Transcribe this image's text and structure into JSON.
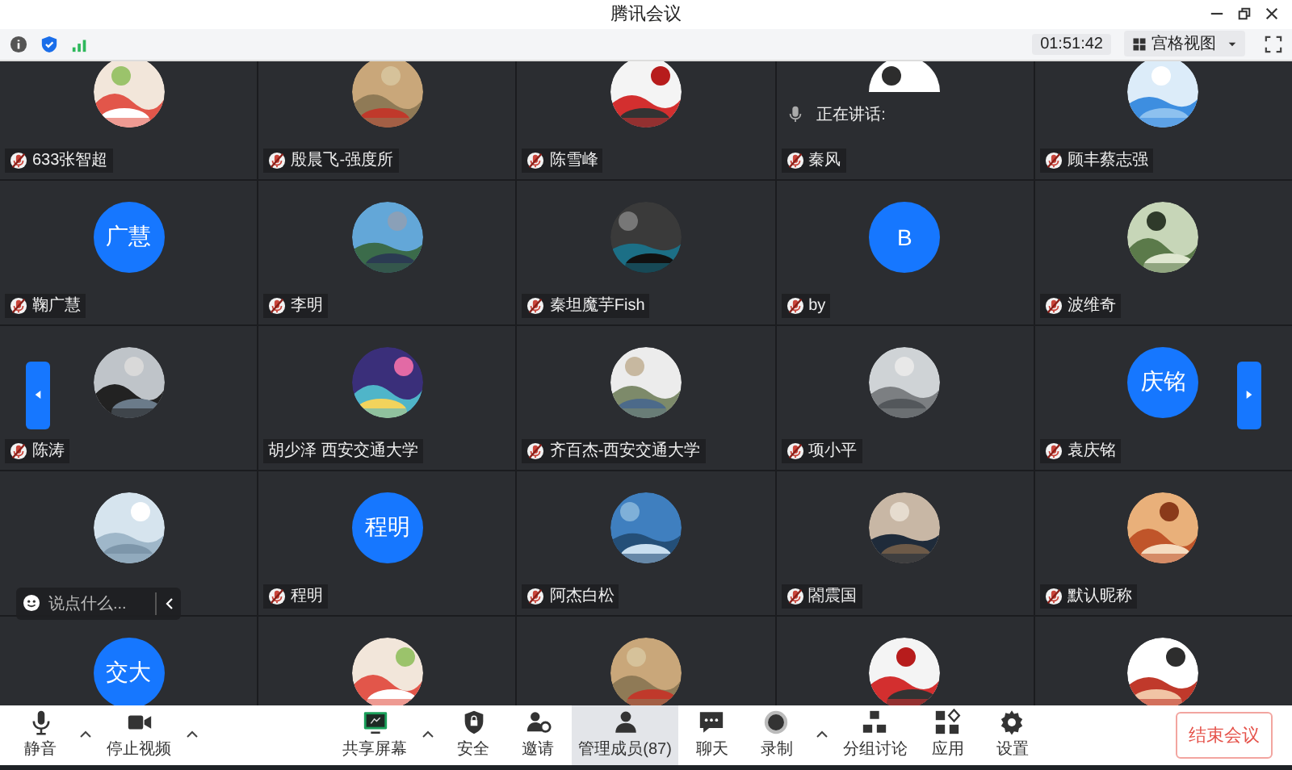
{
  "window": {
    "title": "腾讯会议"
  },
  "toolbar": {
    "timer": "01:51:42",
    "view_button": {
      "label": "宫格视图"
    }
  },
  "chat_input": {
    "placeholder": "说点什么..."
  },
  "page_arrows": {
    "previous": true,
    "next": true
  },
  "tiles": [
    {
      "avatar": {
        "kind": "picture"
      },
      "name": "633张智超",
      "muted": true
    },
    {
      "avatar": {
        "kind": "picture"
      },
      "name": "殷晨飞-强度所",
      "muted": true
    },
    {
      "avatar": {
        "kind": "picture"
      },
      "name": "陈雪峰",
      "muted": true
    },
    {
      "avatar": {
        "kind": "picture"
      },
      "name": "秦风",
      "muted": true,
      "speaking": {
        "label": "正在讲话:"
      }
    },
    {
      "avatar": {
        "kind": "picture"
      },
      "name": "顾丰蔡志强",
      "muted": true
    },
    {
      "avatar": {
        "kind": "initials",
        "text": "广慧"
      },
      "name": "鞠广慧",
      "muted": true
    },
    {
      "avatar": {
        "kind": "picture"
      },
      "name": "李明",
      "muted": true
    },
    {
      "avatar": {
        "kind": "picture"
      },
      "name": "秦坦魔芋Fish",
      "muted": true
    },
    {
      "avatar": {
        "kind": "initials",
        "text": "B"
      },
      "name": "by",
      "muted": true
    },
    {
      "avatar": {
        "kind": "picture"
      },
      "name": "波维奇",
      "muted": true
    },
    {
      "avatar": {
        "kind": "picture"
      },
      "name": "陈涛",
      "muted": true
    },
    {
      "avatar": {
        "kind": "picture"
      },
      "name": "胡少泽 西安交通大学",
      "muted": false
    },
    {
      "avatar": {
        "kind": "picture"
      },
      "name": "齐百杰-西安交通大学",
      "muted": true
    },
    {
      "avatar": {
        "kind": "picture"
      },
      "name": "项小平",
      "muted": true
    },
    {
      "avatar": {
        "kind": "initials",
        "text": "庆铭"
      },
      "name": "袁庆铭",
      "muted": true
    },
    {
      "avatar": {
        "kind": "picture"
      }
    },
    {
      "avatar": {
        "kind": "initials",
        "text": "程明"
      },
      "name": "程明",
      "muted": true
    },
    {
      "avatar": {
        "kind": "picture"
      },
      "name": "阿杰白松",
      "muted": true
    },
    {
      "avatar": {
        "kind": "picture"
      },
      "name": "閤震国",
      "muted": true
    },
    {
      "avatar": {
        "kind": "picture"
      },
      "name": "默认昵称",
      "muted": true
    },
    {
      "avatar": {
        "kind": "initials",
        "text": "交大"
      }
    },
    {
      "avatar": {
        "kind": "picture"
      }
    },
    {
      "avatar": {
        "kind": "picture"
      }
    },
    {
      "avatar": {
        "kind": "picture"
      }
    },
    {
      "avatar": {
        "kind": "picture"
      }
    }
  ],
  "bottom_bar": {
    "items": [
      {
        "kind": "mic",
        "label": "静音",
        "caret": true,
        "selected": false
      },
      {
        "kind": "camera",
        "label": "停止视频",
        "caret": true,
        "selected": false
      },
      {
        "kind": "spacer"
      },
      {
        "kind": "share",
        "label": "共享屏幕",
        "caret": true,
        "selected": false
      },
      {
        "kind": "shield",
        "label": "安全",
        "caret": false,
        "selected": false
      },
      {
        "kind": "invite",
        "label": "邀请",
        "caret": false,
        "selected": false
      },
      {
        "kind": "members",
        "label": "管理成员(87)",
        "caret": false,
        "selected": true
      },
      {
        "kind": "chat",
        "label": "聊天",
        "caret": false,
        "selected": false
      },
      {
        "kind": "record",
        "label": "录制",
        "caret": true,
        "selected": false
      },
      {
        "kind": "breakout",
        "label": "分组讨论",
        "caret": false,
        "selected": false
      },
      {
        "kind": "apps",
        "label": "应用",
        "caret": false,
        "selected": false
      },
      {
        "kind": "settings",
        "label": "设置",
        "caret": false,
        "selected": false
      },
      {
        "kind": "spacer"
      }
    ],
    "end_button": "结束会议"
  }
}
